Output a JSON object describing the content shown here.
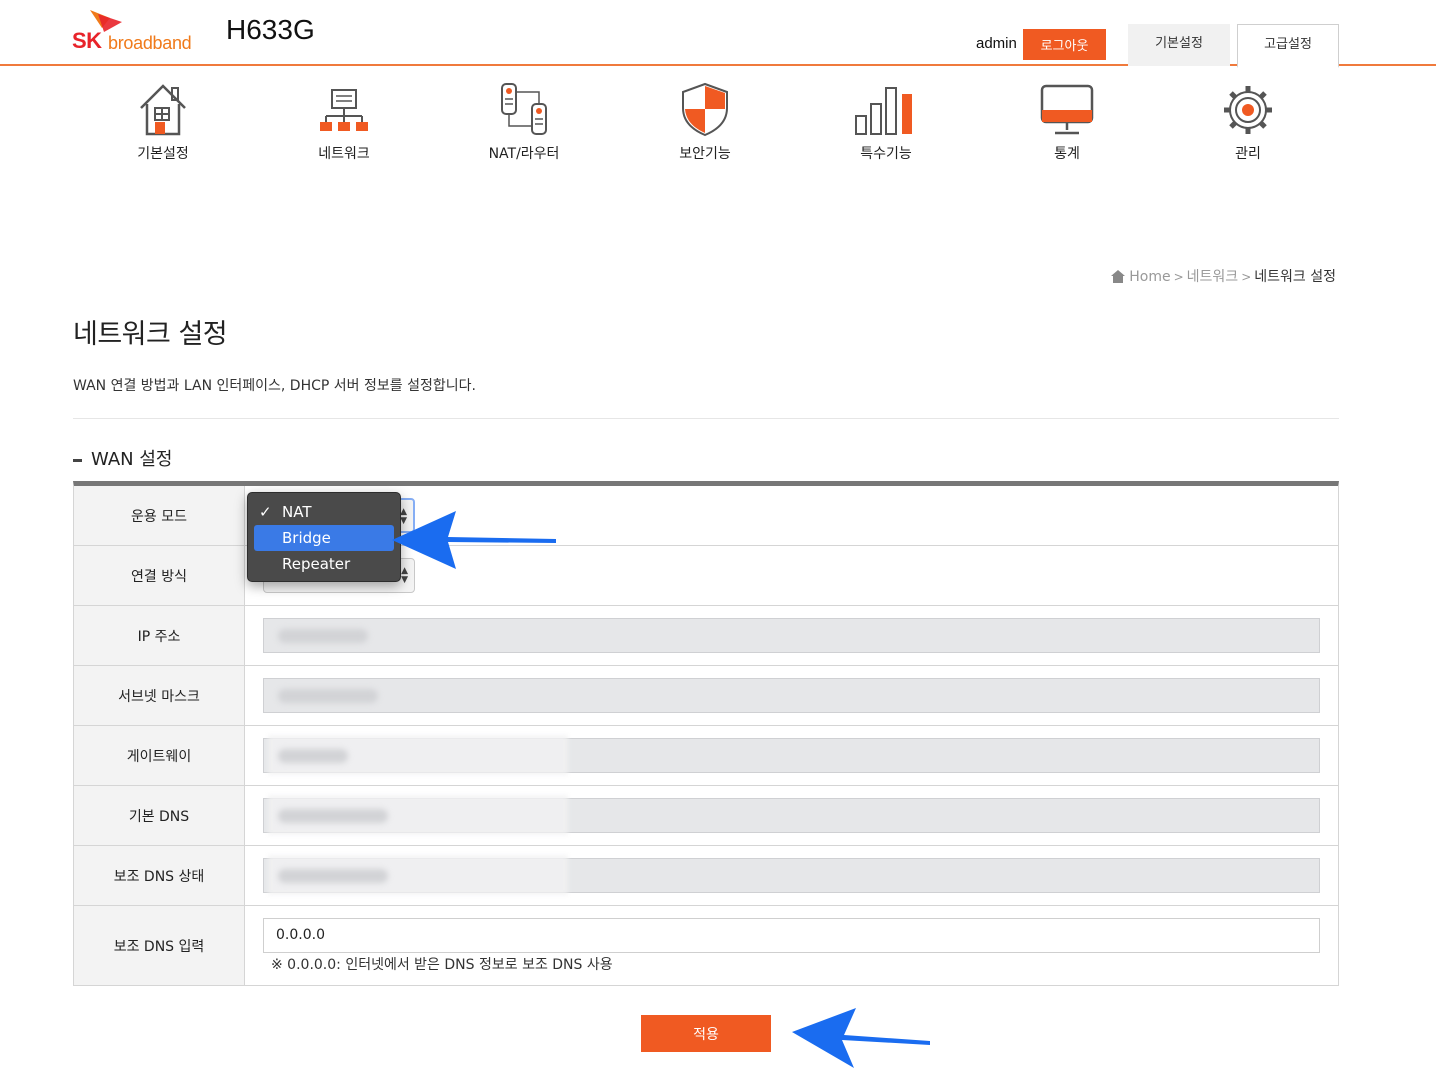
{
  "header": {
    "brand_primary": "SK",
    "brand_secondary": "broadband",
    "model": "H633G",
    "user": "admin",
    "logout_label": "로그아웃",
    "tabs": [
      {
        "label": "기본설정"
      },
      {
        "label": "고급설정"
      }
    ]
  },
  "nav": {
    "items": [
      {
        "label": "기본설정",
        "icon": "house-icon"
      },
      {
        "label": "네트워크",
        "icon": "network-icon"
      },
      {
        "label": "NAT/라우터",
        "icon": "router-icon"
      },
      {
        "label": "보안기능",
        "icon": "shield-icon"
      },
      {
        "label": "특수기능",
        "icon": "bar-chart-icon"
      },
      {
        "label": "통계",
        "icon": "monitor-icon"
      },
      {
        "label": "관리",
        "icon": "gear-icon"
      }
    ]
  },
  "breadcrumb": {
    "home": "Home",
    "sep": ">",
    "level1": "네트워크",
    "current": "네트워크 설정"
  },
  "page": {
    "title": "네트워크 설정",
    "description": "WAN 연결 방법과 LAN 인터페이스, DHCP 서버 정보를 설정합니다."
  },
  "wan": {
    "section_title": "WAN 설정",
    "rows": [
      {
        "label": "운용 모드"
      },
      {
        "label": "연결 방식"
      },
      {
        "label": "IP 주소"
      },
      {
        "label": "서브넷 마스크"
      },
      {
        "label": "게이트웨이"
      },
      {
        "label": "기본 DNS"
      },
      {
        "label": "보조 DNS 상태"
      },
      {
        "label": "보조 DNS 입력"
      }
    ],
    "secondary_dns_value": "0.0.0.0",
    "secondary_dns_hint": "※ 0.0.0.0: 인터넷에서 받은 DNS 정보로 보조 DNS 사용"
  },
  "mode_dropdown": {
    "options": [
      {
        "label": "NAT",
        "checked": true
      },
      {
        "label": "Bridge",
        "highlighted": true
      },
      {
        "label": "Repeater"
      }
    ],
    "check_mark": "✓"
  },
  "apply_label": "적용",
  "colors": {
    "accent": "#f05a22",
    "header_line": "#f07a3c",
    "highlight": "#3a7ae6",
    "annotation_arrow": "#1a6cf0"
  }
}
